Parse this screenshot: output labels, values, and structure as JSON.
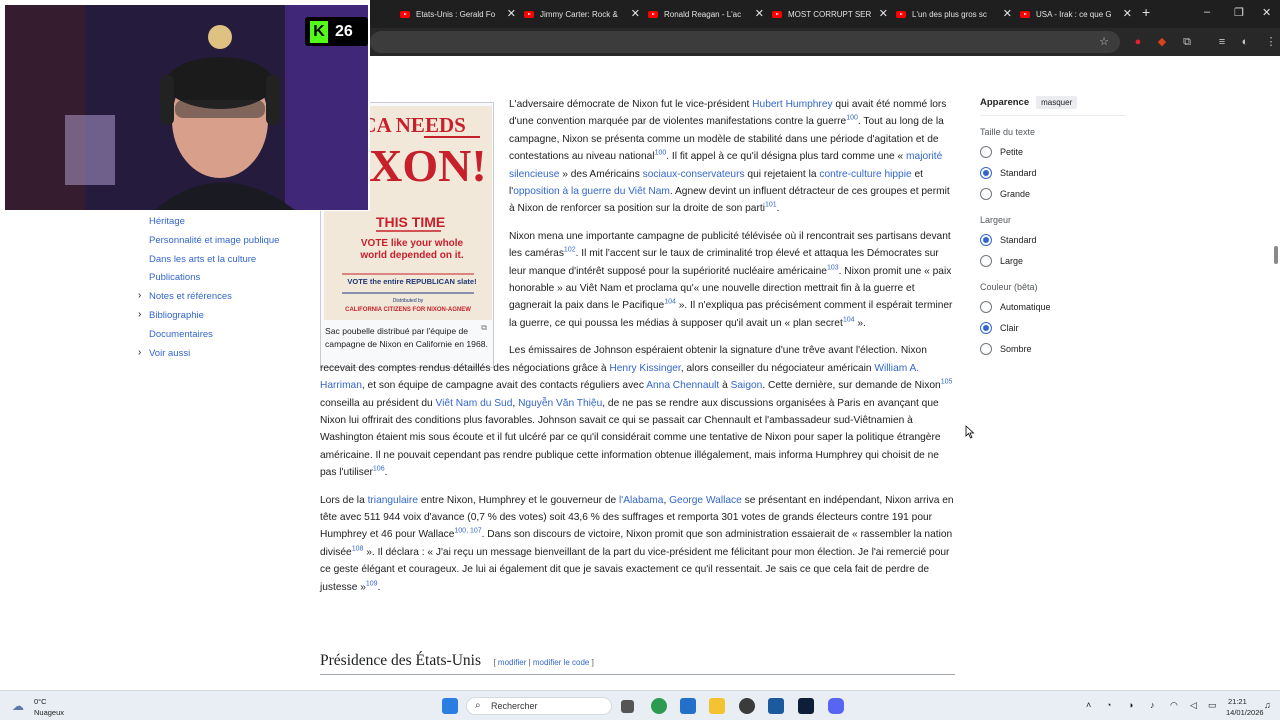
{
  "browser": {
    "tabs": [
      {
        "title": "Etats-Unis : Gerald Fo"
      },
      {
        "title": "Jimmy Carter: Rock &"
      },
      {
        "title": "Ronald Reagan - L'ac"
      },
      {
        "title": "MOST CORRUPT SER"
      },
      {
        "title": "L'un des plus gros sc"
      },
      {
        "title": "USA - Irak : ce que G"
      }
    ],
    "new_tab": "+",
    "window_controls": [
      "–",
      "❐",
      "✕"
    ]
  },
  "sidebar": {
    "toc": [
      {
        "label": "Héritage",
        "expandable": false
      },
      {
        "label": "Personnalité et image publique",
        "expandable": false
      },
      {
        "label": "Dans les arts et la culture",
        "expandable": false
      },
      {
        "label": "Publications",
        "expandable": false
      },
      {
        "label": "Notes et références",
        "expandable": true
      },
      {
        "label": "Bibliographie",
        "expandable": true
      },
      {
        "label": "Documentaires",
        "expandable": false
      },
      {
        "label": "Voir aussi",
        "expandable": true
      }
    ]
  },
  "figure": {
    "poster": {
      "line1": "ERICA NEEDS",
      "line2": "NIXON!",
      "line3": "THIS TIME",
      "line4": "VOTE like your whole world depended on it.",
      "line5": "VOTE the entire REPUBLICAN slate!",
      "line6": "Distributed by",
      "line7": "CALIFORNIA CITIZENS FOR NIXON-AGNEW"
    },
    "caption": "Sac poubelle distribué par l'équipe de campagne de Nixon en Californie en 1968."
  },
  "article": {
    "p1": {
      "a": "L'adversaire démocrate de Nixon fut le vice-président ",
      "l1": "Hubert Humphrey",
      "b": " qui avait été nommé lors d'une convention marquée par de violentes manifestations contre la guerre",
      "s1": "100",
      "c": ". Tout au long de la campagne, Nixon se présenta comme un modèle de stabilité dans une période d'agitation et de contestations au niveau national",
      "s2": "100",
      "d": ". Il fit appel à ce qu'il désigna plus tard comme une « ",
      "l2": "majorité silencieuse",
      "e": " » des Américains ",
      "l3": "sociaux-conservateurs",
      "f": " qui rejetaient la ",
      "l4": "contre-culture hippie",
      "g": " et l'",
      "l5": "opposition à la guerre du Viêt Nam",
      "h": ". Agnew devint un influent détracteur de ces groupes et permit à Nixon de renforcer sa position sur la droite de son parti",
      "s3": "101",
      "i": "."
    },
    "p2": {
      "a": "Nixon mena une importante campagne de publicité télévisée où il rencontrait ses partisans devant les caméras",
      "s1": "102",
      "b": ". Il mit l'accent sur le taux de criminalité trop élevé et attaqua les Démocrates sur leur manque d'intérêt supposé pour la supériorité nucléaire américaine",
      "s2": "103",
      "c": ". Nixon promit une « paix honorable » au Viêt Nam et proclama qu'« une nouvelle direction mettrait fin à la guerre et gagnerait la paix dans le Pacifique",
      "s3": "104",
      "d": " ». Il n'expliqua pas précisément comment il espérait terminer la guerre, ce qui poussa les médias à supposer qu'il avait un « plan secret",
      "s4": "104",
      "e": " »."
    },
    "p3": {
      "a": "Les émissaires de Johnson espéraient obtenir la signature d'une trêve avant l'élection. Nixon recevait des comptes rendus détaillés des négociations grâce à ",
      "l1": "Henry Kissinger",
      "b": ", alors conseiller du négociateur américain ",
      "l2": "William A. Harriman",
      "c": ", et son équipe de campagne avait des contacts réguliers avec ",
      "l3": "Anna Chennault",
      "d": " à ",
      "l4": "Saigon",
      "e": ". Cette dernière, sur demande de Nixon",
      "s1": "105",
      "f": " conseilla au président du ",
      "l5": "Viêt Nam du Sud",
      "g": ", ",
      "l6": "Nguyễn Văn Thiệu",
      "h": ", de ne pas se rendre aux discussions organisées à Paris en avançant que Nixon lui offrirait des conditions plus favorables. Johnson savait ce qui se passait car Chennault et l'ambassadeur sud-Viêtnamien à Washington étaient mis sous écoute et il fut ulcéré par ce qu'il considérait comme une tentative de Nixon pour saper la politique étrangère américaine. Il ne pouvait cependant pas rendre publique cette information obtenue illégalement, mais informa Humphrey qui choisit de ne pas l'utiliser",
      "s2": "106",
      "i": "."
    },
    "p4": {
      "a": "Lors de la ",
      "l1": "triangulaire",
      "b": " entre Nixon, Humphrey et le gouverneur de ",
      "l2": "l'Alabama",
      "c": ", ",
      "l3": "George Wallace",
      "d": " se présentant en indépendant, Nixon arriva en tête avec 511 944 voix d'avance (0,7 % des votes) soit 43,6 % des suffrages et remporta 301 votes de grands électeurs contre 191 pour Humphrey et 46 pour Wallace",
      "s1": "100, 107",
      "e": ". Dans son discours de victoire, Nixon promit que son administration essaierait de « rassembler la nation divisée",
      "s2": "108",
      "f": " ». Il déclara : « J'ai reçu un message bienveillant de la part du vice-président me félicitant pour mon élection. Je l'ai remercié pour ce geste élégant et courageux. Je lui ai également dit que je savais exactement ce qu'il ressentait. Je sais ce que cela fait de perdre de justesse »",
      "s3": "109",
      "g": "."
    },
    "section": {
      "title": "Présidence des États-Unis",
      "edit_open": "[ ",
      "edit1": "modifier",
      "sep": " | ",
      "edit2": "modifier le code",
      "edit_close": " ]"
    }
  },
  "appearance": {
    "title": "Apparence",
    "hide": "masquer",
    "groups": [
      {
        "label": "Taille du texte",
        "options": [
          {
            "label": "Petite",
            "selected": false
          },
          {
            "label": "Standard",
            "selected": true
          },
          {
            "label": "Grande",
            "selected": false
          }
        ]
      },
      {
        "label": "Largeur",
        "options": [
          {
            "label": "Standard",
            "selected": true
          },
          {
            "label": "Large",
            "selected": false
          }
        ]
      },
      {
        "label": "Couleur (bêta)",
        "options": [
          {
            "label": "Automatique",
            "selected": false
          },
          {
            "label": "Clair",
            "selected": true
          },
          {
            "label": "Sombre",
            "selected": false
          }
        ]
      }
    ]
  },
  "stream": {
    "badge_letter": "K",
    "viewer_count": "26"
  },
  "taskbar": {
    "weather_temp": "0°C",
    "weather_desc": "Nuageux",
    "search_label": "Rechercher",
    "time": "21:21",
    "date": "14/01/2026"
  },
  "colors": {
    "link": "#3366cc",
    "accent": "#3366cc",
    "poster_red": "#c8202b",
    "poster_blue": "#203a78",
    "kick_green": "#53fc18"
  }
}
